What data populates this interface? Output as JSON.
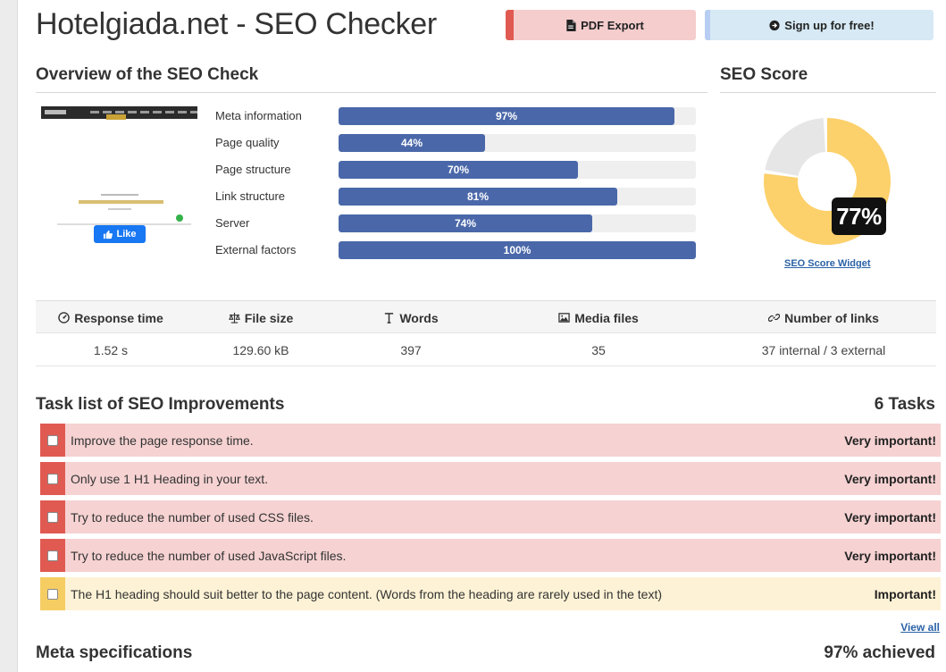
{
  "header": {
    "title": "Hotelgiada.net - SEO Checker",
    "pdf_export_label": "PDF Export",
    "signup_label": "Sign up for free!"
  },
  "overview": {
    "title": "Overview of the SEO Check",
    "like_label": "Like",
    "metrics": [
      {
        "label": "Meta information",
        "value": 97,
        "display": "97%"
      },
      {
        "label": "Page quality",
        "value": 44,
        "display": "44%"
      },
      {
        "label": "Page structure",
        "value": 70,
        "display": "70%"
      },
      {
        "label": "Link structure",
        "value": 81,
        "display": "81%"
      },
      {
        "label": "Server",
        "value": 74,
        "display": "74%"
      },
      {
        "label": "External factors",
        "value": 100,
        "display": "100%"
      }
    ],
    "bar_color": "#4a68a9"
  },
  "seo_score": {
    "title": "SEO Score",
    "value": 77,
    "display": "77%",
    "widget_link": "SEO Score Widget",
    "fill_color": "#fcd06a",
    "rest_color": "#e6e6e6"
  },
  "stats": {
    "headers": [
      {
        "label": "Response time",
        "icon": "gauge-icon"
      },
      {
        "label": "File size",
        "icon": "scale-icon"
      },
      {
        "label": "Words",
        "icon": "text-size-icon"
      },
      {
        "label": "Media files",
        "icon": "image-icon"
      },
      {
        "label": "Number of links",
        "icon": "link-icon"
      }
    ],
    "values": [
      "1.52 s",
      "129.60 kB",
      "397",
      "35",
      "37 internal / 3 external"
    ]
  },
  "tasks": {
    "title": "Task list of SEO Improvements",
    "count": "6 Tasks",
    "items": [
      {
        "text": "Improve the page response time.",
        "priority": "Very important!",
        "level": "red"
      },
      {
        "text": "Only use 1 H1 Heading in your text.",
        "priority": "Very important!",
        "level": "red"
      },
      {
        "text": "Try to reduce the number of used CSS files.",
        "priority": "Very important!",
        "level": "red"
      },
      {
        "text": "Try to reduce the number of used JavaScript files.",
        "priority": "Very important!",
        "level": "red"
      },
      {
        "text": "The H1 heading should suit better to the page content. (Words from the heading are rarely used in the text)",
        "priority": "Important!",
        "level": "yellow"
      }
    ],
    "view_all": "View all"
  },
  "meta": {
    "title": "Meta specifications",
    "achieved": "97% achieved"
  },
  "colors": {
    "very_important": "#e05a52",
    "important": "#f5cd63",
    "link": "#2a62a6"
  }
}
